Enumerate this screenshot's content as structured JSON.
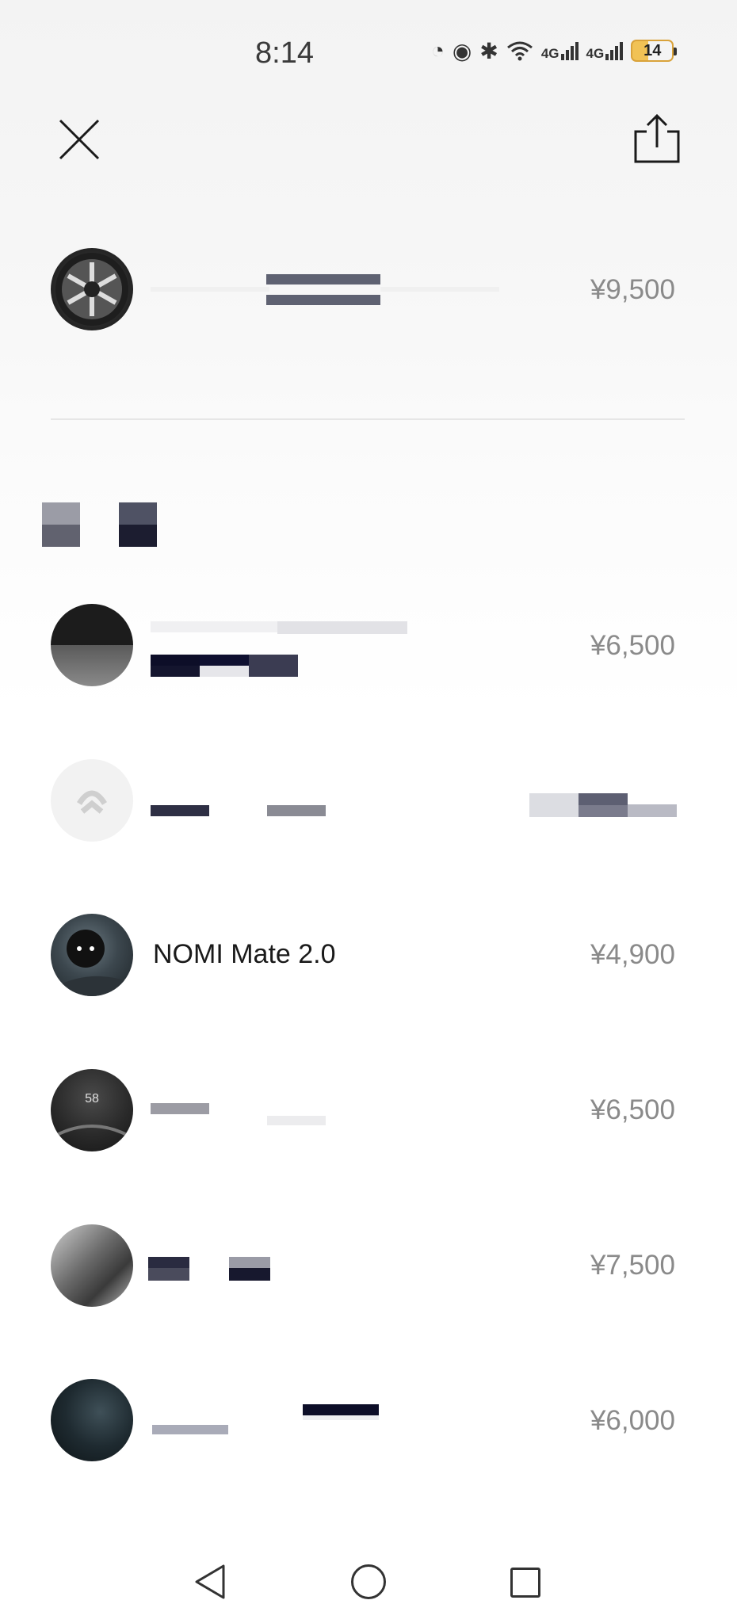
{
  "status_bar": {
    "time": "8:14",
    "battery": "14",
    "network_1": "4G",
    "network_2": "4G"
  },
  "header": {
    "close_icon": "close-icon",
    "share_icon": "share-icon"
  },
  "featured": {
    "price": "¥9,500"
  },
  "items": [
    {
      "price": "¥6,500"
    },
    {
      "price": ""
    },
    {
      "name": "NOMI Mate 2.0",
      "price": "¥4,900"
    },
    {
      "price": "¥6,500"
    },
    {
      "price": "¥7,500"
    },
    {
      "price": "¥6,000"
    }
  ],
  "colors": {
    "price_text": "#8a8a8a",
    "title_text": "#1a1a1a",
    "battery_accent": "#f1c255"
  }
}
